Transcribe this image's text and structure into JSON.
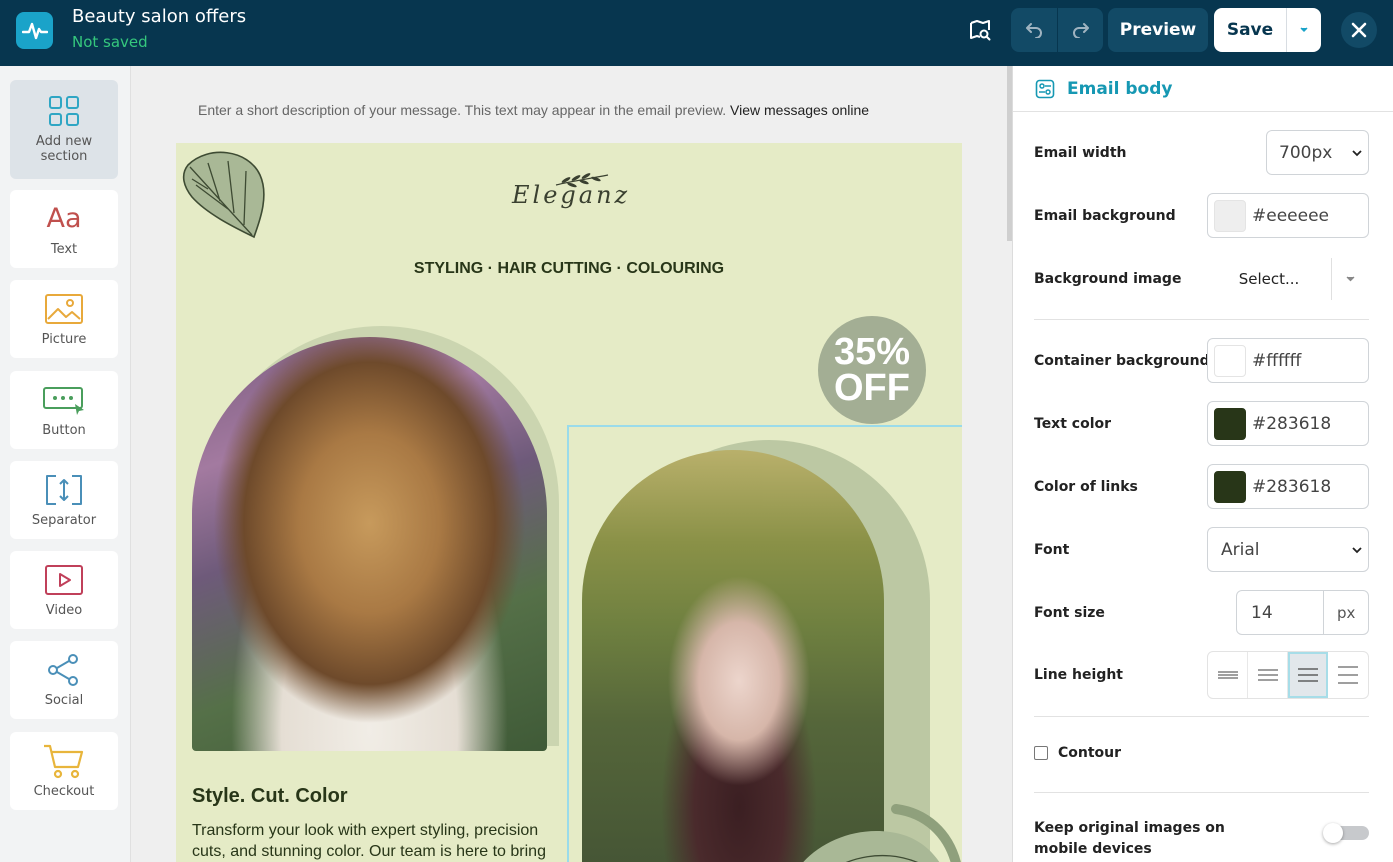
{
  "header": {
    "title": "Beauty salon offers",
    "status": "Not saved",
    "preview_label": "Preview",
    "save_label": "Save"
  },
  "sidebar": {
    "items": [
      {
        "label": "Add new section",
        "icon": "grid-icon"
      },
      {
        "label": "Text",
        "icon": "text-icon"
      },
      {
        "label": "Picture",
        "icon": "picture-icon"
      },
      {
        "label": "Button",
        "icon": "button-icon"
      },
      {
        "label": "Separator",
        "icon": "separator-icon"
      },
      {
        "label": "Video",
        "icon": "video-icon"
      },
      {
        "label": "Social",
        "icon": "social-icon"
      },
      {
        "label": "Checkout",
        "icon": "cart-icon"
      }
    ]
  },
  "canvas": {
    "preheader": "Enter a short description of your message. This text may appear in the email preview.",
    "view_online": "View messages online",
    "brand": "Eleganz",
    "tagline": "STYLING · HAIR CUTTING · COLOURING",
    "badge_line1": "35%",
    "badge_line2": "OFF",
    "heading": "Style. Cut. Color",
    "body": "Transform your look with expert styling, precision cuts, and stunning color. Our team is here to bring"
  },
  "panel": {
    "title": "Email body",
    "email_width_label": "Email width",
    "email_width_value": "700px",
    "email_bg_label": "Email background",
    "email_bg_value": "#eeeeee",
    "bg_image_label": "Background image",
    "bg_image_value": "Select...",
    "container_bg_label": "Container background",
    "container_bg_value": "#ffffff",
    "text_color_label": "Text color",
    "text_color_value": "#283618",
    "link_color_label": "Color of links",
    "link_color_value": "#283618",
    "font_label": "Font",
    "font_value": "Arial",
    "font_size_label": "Font size",
    "font_size_value": "14",
    "font_size_unit": "px",
    "line_height_label": "Line height",
    "contour_label": "Contour",
    "keep_images_label": "Keep original images on mobile devices"
  },
  "colors": {
    "topbar": "#07364f",
    "accent": "#1698b3",
    "status_green": "#35c77d",
    "email_bg": "#eeeeee",
    "container_bg": "#ffffff",
    "text": "#283618"
  }
}
